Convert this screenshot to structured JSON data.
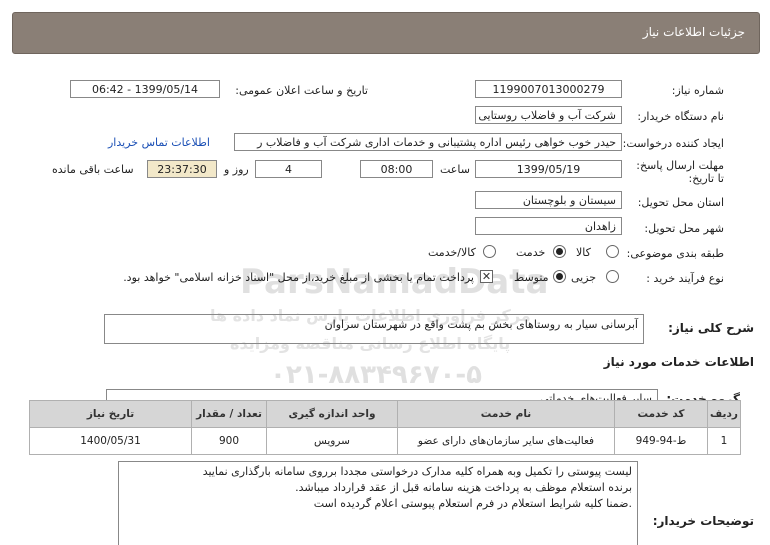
{
  "header": {
    "title": "جزئیات اطلاعات نیاز"
  },
  "fields": {
    "need_number_label": "شماره نیاز:",
    "need_number": "1199007013000279",
    "announce_label": "تاریخ و ساعت اعلان عمومی:",
    "announce_value": "1399/05/14 - 06:42",
    "buyer_label": "نام دستگاه خریدار:",
    "buyer_value": "شرکت آب و فاضلاب روستایی",
    "creator_label": "ایجاد کننده درخواست:",
    "creator_value": "حیدر خوب خواهی  رئیس اداره پشتیبانی و خدمات اداری  شرکت آب و فاضلاب ر",
    "contact_link": "اطلاعات تماس خریدار",
    "deadline_label": "مهلت ارسال پاسخ: تا تاریخ:",
    "deadline_date": "1399/05/19",
    "time_label": "ساعت",
    "deadline_time": "08:00",
    "days_value": "4",
    "days_label": "روز و",
    "remaining_time": "23:37:30",
    "remaining_label": "ساعت باقی مانده",
    "province_label": "استان محل تحویل:",
    "province_value": "سیستان و بلوچستان",
    "city_label": "شهر محل تحویل:",
    "city_value": "زاهدان",
    "category_label": "طبقه بندی موضوعی:",
    "category_options": [
      "کالا",
      "خدمت",
      "کالا/خدمت"
    ],
    "category_selected": "خدمت",
    "process_label": "نوع فرآیند خرید :",
    "process_options": [
      "جزیی",
      "متوسط"
    ],
    "process_selected": "متوسط",
    "payment_note": "پرداخت تمام یا بخشی از مبلغ خرید،از محل \"اسناد خزانه اسلامی\" خواهد بود.",
    "payment_checked": true
  },
  "description": {
    "label": "شرح کلی نیاز:",
    "value": "آبرسانی سیار به روستاهای بخش بم پشت    واقع در شهرستان سراوان"
  },
  "services": {
    "section_title": "اطلاعات خدمات مورد نیاز",
    "group_label": "گروه خدمت:",
    "group_value": "سایر فعالیت‌های خدماتی",
    "columns": [
      "ردیف",
      "کد خدمت",
      "نام خدمت",
      "واحد اندازه گیری",
      "تعداد / مقدار",
      "تاریخ نیاز"
    ],
    "rows": [
      [
        "1",
        "ط-94-949",
        "فعالیت‌های سایر سازمان‌های دارای عضو",
        "سرویس",
        "900",
        "1400/05/31"
      ]
    ]
  },
  "notes": {
    "label": "توضیحات خریدار:",
    "lines": [
      "لیست پیوستی را تکمیل وبه همراه کلیه مدارک درخواستی مجددا برروی سامانه بارگذاری نمایید",
      "برنده استعلام موظف به پرداخت هزینه سامانه قبل از عقد قرارداد میباشد.",
      ".ضمنا کلیه شرایط استعلام در فرم استعلام پیوستی اعلام گردیده است"
    ]
  },
  "watermark": {
    "line1": "ParsNamadData",
    "line2": "مرکز فراوری اطلاعات پارس نماد داده ها",
    "line3": "پایگاه اطلاع رسانی مناقصه ومزایده",
    "line4": "۰۲۱-۸۸۳۴۹۶۷۰-۵"
  }
}
